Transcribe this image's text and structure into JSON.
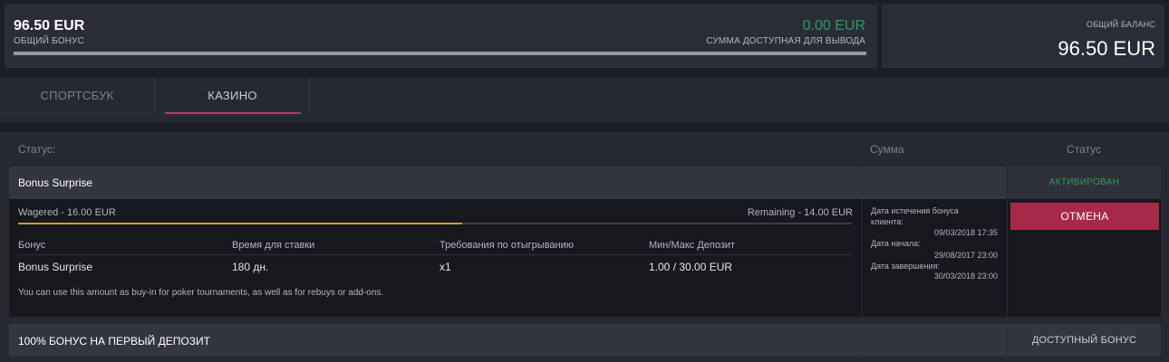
{
  "summary": {
    "bonus_amount": "96.50 EUR",
    "bonus_label": "ОБЩИЙ БОНУС",
    "withdraw_amount": "0.00 EUR",
    "withdraw_label": "СУММА ДОСТУПНАЯ ДЛЯ ВЫВОДА",
    "balance_label": "ОБЩИЙ БАЛАНС",
    "balance_amount": "96.50 EUR"
  },
  "tabs": [
    {
      "label": "СПОРТСБУК",
      "active": false
    },
    {
      "label": "КАЗИНО",
      "active": true
    }
  ],
  "table_header": {
    "status_left": "Статус:",
    "sum": "Сумма",
    "status": "Статус"
  },
  "bonuses": [
    {
      "title": "Bonus Surprise",
      "status": "АКТИВИРОВАН",
      "wagered": "Wagered - 16.00 EUR",
      "remaining": "Remaining - 14.00 EUR",
      "wager_progress": 0.533,
      "columns": [
        "Бонус",
        "Время для ставки",
        "Требования по отыгрыванию",
        "Мин/Макс Депозит"
      ],
      "values": [
        "Bonus Surprise",
        "180 дн.",
        "x1",
        "1.00 / 30.00 EUR"
      ],
      "note": "You can use this amount as buy-in for poker tournaments, as well as for rebuys or add-ons.",
      "dates": {
        "expiry_label_1": "Дата истечения бонуса",
        "expiry_label_2": "клиента:",
        "expiry_value": "09/03/2018 17:35",
        "start_label": "Дата начала:",
        "start_value": "29/08/2017 23:00",
        "end_label": "Дата завершения:",
        "end_value": "30/03/2018 23:00"
      },
      "action_label": "ОТМЕНА"
    },
    {
      "title": "100% БОНУС НА ПЕРВЫЙ ДЕПОЗИТ",
      "status": "ДОСТУПНЫЙ БОНУС"
    }
  ],
  "colors": {
    "accent_pink": "#c33472",
    "success_green": "#2e9b5a",
    "cancel_red": "#a62a48",
    "progress_gold": "#c9a22d"
  }
}
